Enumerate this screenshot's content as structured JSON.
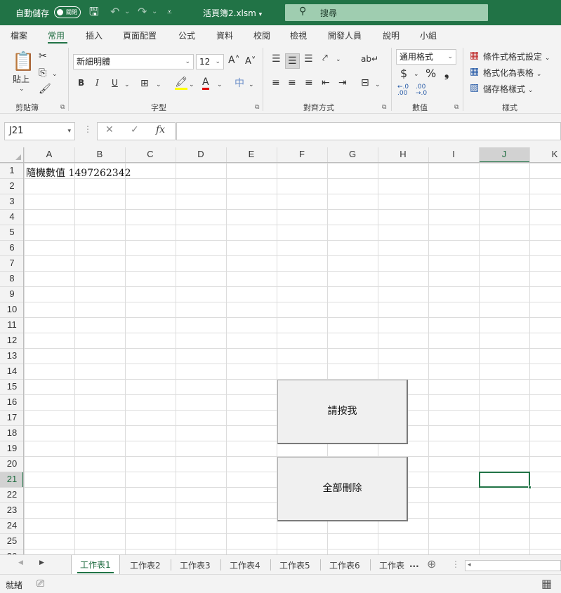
{
  "titlebar": {
    "autosave_label": "自動儲存",
    "autosave_state": "關閉",
    "filename": "活頁簿2.xlsm",
    "search_placeholder": "搜尋",
    "accent": "#217346"
  },
  "menu_tabs": [
    "檔案",
    "常用",
    "插入",
    "頁面配置",
    "公式",
    "資料",
    "校閱",
    "檢視",
    "開發人員",
    "說明",
    "小組"
  ],
  "active_menu_tab": "常用",
  "ribbon": {
    "clipboard": {
      "paste_label": "貼上",
      "group_label": "剪貼簿"
    },
    "font": {
      "font_name": "新細明體",
      "font_size": "12",
      "bold": "B",
      "italic": "I",
      "underline": "U",
      "grow": "A˄",
      "shrink": "A˅",
      "group_label": "字型"
    },
    "alignment": {
      "group_label": "對齊方式"
    },
    "number": {
      "format": "通用格式",
      "currency": "$",
      "percent": "%",
      "comma": "❟",
      "inc_dec": "←.0 .00",
      "dec_dec": ".00 →.0",
      "group_label": "數值"
    },
    "styles": {
      "conditional": "條件式格式設定",
      "as_table": "格式化為表格",
      "cell_styles": "儲存格樣式",
      "group_label": "樣式"
    }
  },
  "formula_bar": {
    "name_box": "J21",
    "fx_label": "fx",
    "value": ""
  },
  "grid": {
    "columns": [
      "A",
      "B",
      "C",
      "D",
      "E",
      "F",
      "G",
      "H",
      "I",
      "J",
      "K"
    ],
    "rows": [
      "1",
      "2",
      "3",
      "4",
      "5",
      "6",
      "7",
      "8",
      "9",
      "10",
      "11",
      "12",
      "13",
      "14",
      "15",
      "16",
      "17",
      "18",
      "19",
      "20",
      "21",
      "22",
      "23",
      "24",
      "25",
      "26"
    ],
    "selected_column": "J",
    "selected_row": "21",
    "cell_A1": "隨機數值 1497262342"
  },
  "buttons": {
    "press_me": "請按我",
    "delete_all": "全部刪除"
  },
  "sheets": [
    "工作表1",
    "工作表2",
    "工作表3",
    "工作表4",
    "工作表5",
    "工作表6",
    "工作表"
  ],
  "active_sheet": "工作表1",
  "sheet_more": "...",
  "status": {
    "ready": "就緒"
  }
}
